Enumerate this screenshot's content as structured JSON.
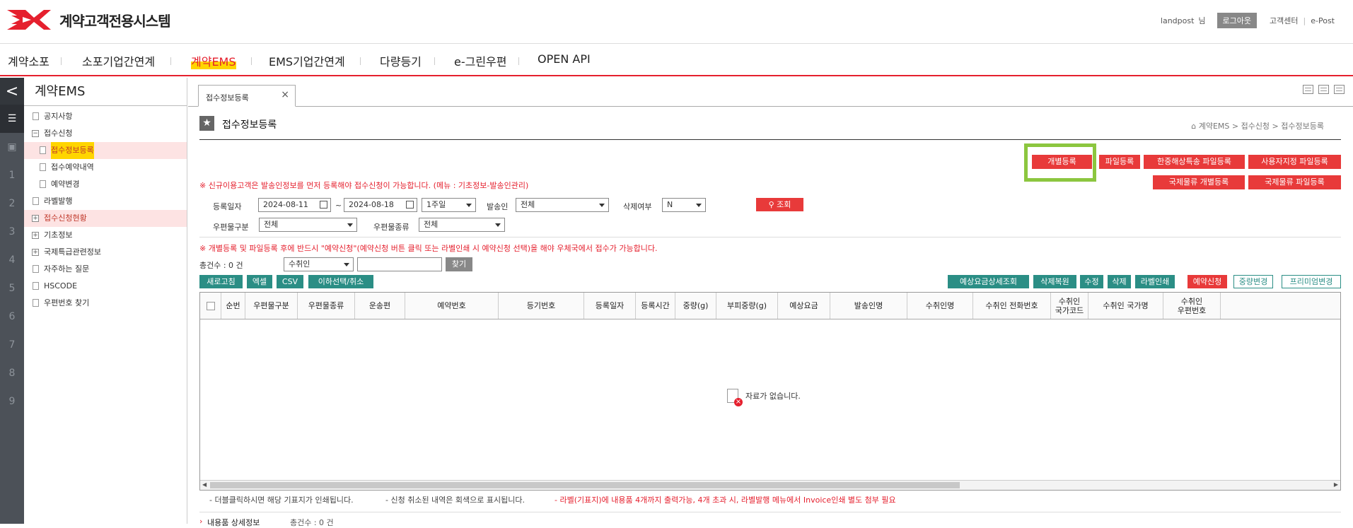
{
  "header": {
    "app_title": "계약고객전용시스템",
    "user": "landpost",
    "honorific": "님",
    "logout": "로그아웃",
    "links": [
      "고객센터",
      "e-Post"
    ]
  },
  "gnb": [
    "계약소포",
    "소포기업간연계",
    "계약EMS",
    "EMS기업간연계",
    "다량등기",
    "e-그린우편",
    "OPEN API"
  ],
  "leftnav": {
    "collapse": "<",
    "icons": [
      "1",
      "2",
      "3",
      "4",
      "5",
      "6",
      "7",
      "8",
      "9"
    ]
  },
  "sidebar": {
    "title": "계약EMS",
    "items": [
      "공지사항",
      "접수신청",
      "접수정보등록",
      "접수예약내역",
      "예약변경",
      "라벨발행",
      "접수신청현황",
      "기초정보",
      "국제특급관련정보",
      "자주하는 질문",
      "HSCODE",
      "우편번호 찾기"
    ]
  },
  "tab": {
    "label": "접수정보등록",
    "close": "×"
  },
  "page": {
    "title": "접수정보등록",
    "breadcrumb": "계약EMS > 접수신청 > 접수정보등록"
  },
  "actions": {
    "row1": [
      "개별등록",
      "파일등록",
      "한중해상특송 파일등록",
      "사용자지정 파일등록"
    ],
    "row2": [
      "국제물류 개별등록",
      "국제물류 파일등록"
    ]
  },
  "notice1": "※ 신규이용고객은 발송인정보를 먼저 등록해야 접수신청이 가능합니다. (메뉴 : 기초정보-발송인관리)",
  "search": {
    "reg_date_label": "등록일자",
    "date_from": "2024-08-11",
    "tilde": "~",
    "date_to": "2024-08-18",
    "period": "1주일",
    "sender_label": "발송인",
    "sender": "전체",
    "deleted_label": "삭제여부",
    "deleted": "N",
    "search_btn": "조회",
    "mail_class_label": "우편물구분",
    "mail_class": "전체",
    "mail_type_label": "우편물종류",
    "mail_type": "전체"
  },
  "notice2": "※ 개별등록 및 파일등록 후에 반드시 \"예약신청\"(예약신청 버튼 클릭 또는 라벨인쇄 시 예약신청 선택)을 해야 우체국에서 접수가 가능합니다.",
  "total": "총건수 : 0 건",
  "find": {
    "select": "수취인",
    "value": "",
    "btn": "찾기"
  },
  "left_buttons": [
    "새로고침",
    "엑셀",
    "CSV",
    "이하선택/취소"
  ],
  "right_buttons": [
    "예상요금상세조회",
    "삭제복원",
    "수정",
    "삭제",
    "라벨인쇄",
    "예약신청",
    "중량변경",
    "프리미엄변경"
  ],
  "columns": [
    "",
    "순번",
    "우편물구분",
    "우편물종류",
    "운송편",
    "예약번호",
    "등기번호",
    "등록일자",
    "등록시간",
    "중량(g)",
    "부피중량(g)",
    "예상요금",
    "발송인명",
    "수취인명",
    "수취인 전화번호",
    "수취인\n국가코드",
    "수취인 국가명",
    "수취인\n우편번호"
  ],
  "empty": "자료가 없습니다.",
  "footnotes": [
    "- 더블클릭하시면 해당 기표지가 인쇄됩니다.",
    "- 신청 취소된 내역은 회색으로 표시됩니다.",
    "- 라벨(기표지)에 내용품 4개까지 출력가능, 4개 초과 시, 라벨발행 메뉴에서 Invoice인쇄 별도 첨부 필요"
  ],
  "bottom": {
    "detail": "내용품 상세정보",
    "count": "총건수 : 0 건"
  }
}
